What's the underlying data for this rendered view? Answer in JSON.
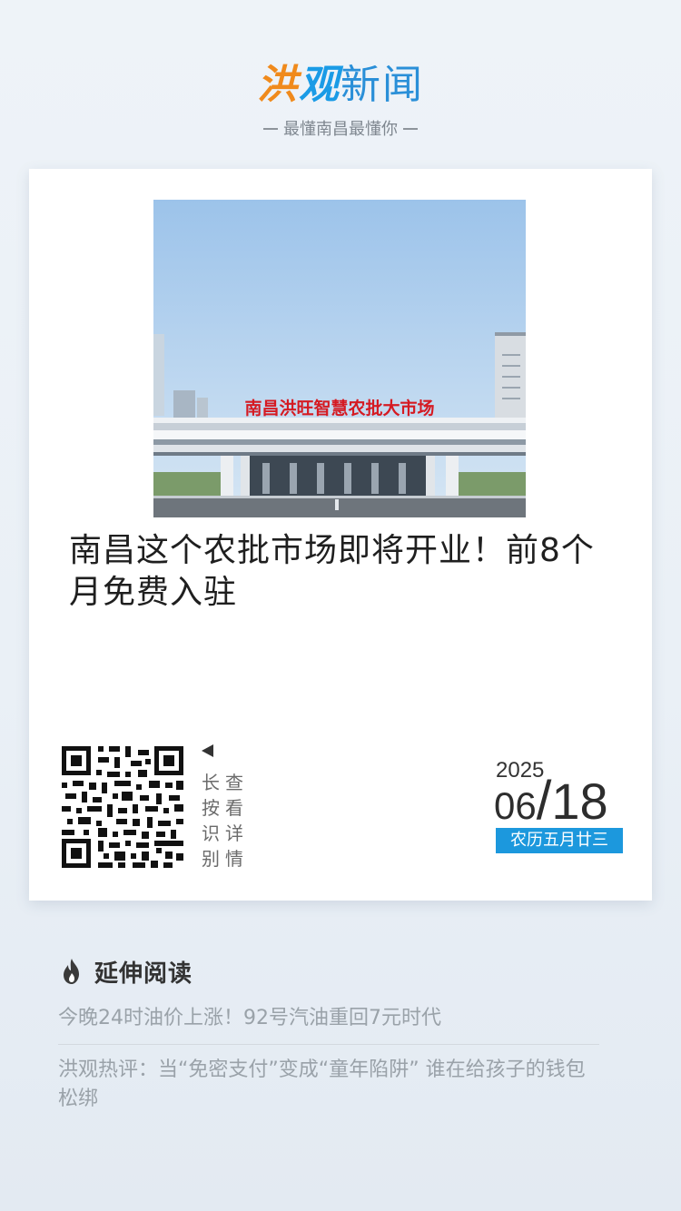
{
  "header": {
    "logo": {
      "part1": "洪",
      "part2": "观",
      "part3": "新闻"
    },
    "slogan": "最懂南昌最懂你"
  },
  "card": {
    "photo": {
      "sign_text": "南昌洪旺智慧农批大市场"
    },
    "headline": "南昌这个农批市场即将开业！前8个月免费入驻",
    "qr_hint": {
      "col1": "长按识别",
      "col2": "查看详情"
    },
    "date": {
      "year": "2025",
      "month": "06",
      "slash": "/",
      "day": "18",
      "lunar": "农历五月廿三"
    }
  },
  "related": {
    "title": "延伸阅读",
    "items": [
      "今晚24时油价上涨！92号汽油重回7元时代",
      "洪观热评：当“免密支付”变成“童年陷阱” 谁在给孩子的钱包松绑"
    ]
  },
  "colors": {
    "logo_orange": "#f08a1c",
    "logo_blue": "#1a9be6",
    "lunar_bg": "#1c98dd"
  },
  "icons": {
    "related": "fire-icon",
    "qr_arrow": "arrow-left-icon"
  }
}
